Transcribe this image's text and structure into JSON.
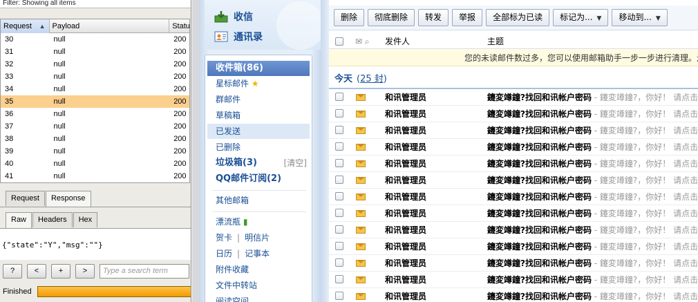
{
  "burp": {
    "filter": "Filter: Showing all items",
    "columns": {
      "request": "Request",
      "payload": "Payload",
      "status": "Statu"
    },
    "rows": [
      {
        "request": "30",
        "payload": "null",
        "status": "200"
      },
      {
        "request": "31",
        "payload": "null",
        "status": "200"
      },
      {
        "request": "32",
        "payload": "null",
        "status": "200"
      },
      {
        "request": "33",
        "payload": "null",
        "status": "200"
      },
      {
        "request": "34",
        "payload": "null",
        "status": "200"
      },
      {
        "request": "35",
        "payload": "null",
        "status": "200"
      },
      {
        "request": "36",
        "payload": "null",
        "status": "200"
      },
      {
        "request": "37",
        "payload": "null",
        "status": "200"
      },
      {
        "request": "38",
        "payload": "null",
        "status": "200"
      },
      {
        "request": "39",
        "payload": "null",
        "status": "200"
      },
      {
        "request": "40",
        "payload": "null",
        "status": "200"
      },
      {
        "request": "41",
        "payload": "null",
        "status": "200"
      }
    ],
    "selected_request": "35",
    "tabs_main": [
      "Request",
      "Response"
    ],
    "tabs_view": [
      "Raw",
      "Headers",
      "Hex"
    ],
    "response_body": "{\"state\":\"Y\",\"msg\":\"\"}",
    "toolbar": {
      "help": "?",
      "prev": "<",
      "add": "+",
      "next": ">"
    },
    "search_placeholder": "Type a search term",
    "status": "Finished",
    "progress_fraction": 1.0,
    "colors": {
      "selected_row": "#fbcf8e",
      "progress": "#f39a00"
    }
  },
  "nav": {
    "top_items": [
      {
        "label": "收信",
        "icon": "receive-mail-icon"
      },
      {
        "label": "通讯录",
        "icon": "contacts-icon"
      }
    ],
    "folders": {
      "inbox": "收件箱(86)",
      "starred": "星标邮件",
      "group": "群邮件",
      "drafts": "草稿箱",
      "sent": "已发送",
      "deleted": "已删除",
      "spam": "垃圾箱(3)",
      "spam_clear": "[清空]",
      "subscriptions": "QQ邮件订阅(2)",
      "other_mailbox": "其他邮箱",
      "drift_bottle": "漂流瓶",
      "greeting_card": "贺卡",
      "postcard": "明信片",
      "calendar": "日历",
      "notepad": "记事本",
      "attachments": "附件收藏",
      "file_transfer": "文件中转站",
      "reading_space": "阅读空间"
    }
  },
  "main": {
    "toolbar": {
      "delete": "删除",
      "delete_permanently": "彻底删除",
      "forward": "转发",
      "report": "举报",
      "mark_all_read": "全部标为已读",
      "mark_as": "标记为...",
      "move_to": "移动到..."
    },
    "columns": {
      "sender": "发件人",
      "subject": "主题"
    },
    "notice": "您的未读邮件数过多，您可以使用邮箱助手一步一步进行清理。走",
    "group": {
      "label": "今天",
      "count_prefix": "(",
      "count": "25 封",
      "count_suffix": ")"
    },
    "mails": [
      {
        "sender": "和讯管理员",
        "subject": "鑳変竴鐘?找回和讯帐户密码",
        "preview": " - 鑳変竴鐘?，你好！  请点击"
      },
      {
        "sender": "和讯管理员",
        "subject": "鑳変竴鐘?找回和讯帐户密码",
        "preview": " - 鑳変竴鐘?，你好！  请点击"
      },
      {
        "sender": "和讯管理员",
        "subject": "鑳変竴鐘?找回和讯帐户密码",
        "preview": " - 鑳変竴鐘?，你好！  请点击"
      },
      {
        "sender": "和讯管理员",
        "subject": "鑳変竴鐘?找回和讯帐户密码",
        "preview": " - 鑳変竴鐘?，你好！  请点击"
      },
      {
        "sender": "和讯管理员",
        "subject": "鑳変竴鐘?找回和讯帐户密码",
        "preview": " - 鑳変竴鐘?，你好！  请点击"
      },
      {
        "sender": "和讯管理员",
        "subject": "鑳変竴鐘?找回和讯帐户密码",
        "preview": " - 鑳変竴鐘?，你好！  请点击"
      },
      {
        "sender": "和讯管理员",
        "subject": "鑳変竴鐘?找回和讯帐户密码",
        "preview": " - 鑳変竴鐘?，你好！  请点击"
      },
      {
        "sender": "和讯管理员",
        "subject": "鑳変竴鐘?找回和讯帐户密码",
        "preview": " - 鑳変竴鐘?，你好！  请点击"
      },
      {
        "sender": "和讯管理员",
        "subject": "鑳変竴鐘?找回和讯帐户密码",
        "preview": " - 鑳変竴鐘?，你好！  请点击"
      },
      {
        "sender": "和讯管理员",
        "subject": "鑳変竴鐘?找回和讯帐户密码",
        "preview": " - 鑳変竴鐘?，你好！  请点击"
      },
      {
        "sender": "和讯管理员",
        "subject": "鑳変竴鐘?找回和讯帐户密码",
        "preview": " - 鑳変竴鐘?，你好！  请点击"
      },
      {
        "sender": "和讯管理员",
        "subject": "鑳変竴鐘?找回和讯帐户密码",
        "preview": " - 鑳変竴鐘?，你好！  请点击"
      },
      {
        "sender": "和讯管理员",
        "subject": "鑳変竴鐘?找回和讯帐户密码",
        "preview": " - 鑳変竴鐘?，你好！  请点击"
      }
    ]
  }
}
